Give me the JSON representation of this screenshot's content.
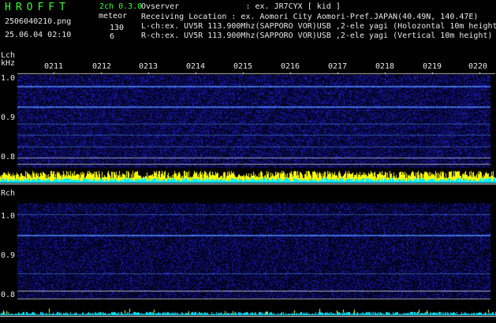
{
  "header": {
    "brand": "HROFFT",
    "filename": "2506040210.png",
    "datetime": "25.06.04 02:10",
    "version": "2ch 0.3.0",
    "meteor_label": "meteor",
    "lch_count": "130",
    "rch_count": "6",
    "observer": "Ovserver              : ex. JR7CYX [ kid ]",
    "location": "Receiving Location : ex. Aomori City Aomori-Pref.JAPAN(40.49N, 140.47E)",
    "lch_info": "L-ch:ex. UV5R 113.900Mhz(SAPPORO VOR)USB ,2-ele yagi (Holozontal 10m height)",
    "rch_info": "R-ch:ex. UV5R 113.900Mhz(SAPPORO VOR)USB ,2-ele yagi (Vertical 10m height)"
  },
  "time_ticks": [
    "0211",
    "0212",
    "0213",
    "0214",
    "0215",
    "0216",
    "0217",
    "0218",
    "0219",
    "0220"
  ],
  "lch_panel": {
    "label": "Lch",
    "unit": "kHz",
    "y_labels": [
      "1.0",
      "0.9",
      "0.8"
    ]
  },
  "rch_panel": {
    "label": "Rch",
    "y_labels": [
      "1.0",
      "0.9",
      "0.8"
    ]
  },
  "colors": {
    "background": "#000000",
    "text": "#e8e8e8",
    "brand": "#33ff33",
    "noise": "#1a1a9a",
    "carrier": "#4a7cff",
    "meteor_bar_yellow": "#ffff00",
    "meteor_bar_cyan": "#00ffff",
    "divider": "#c8c8c8"
  }
}
